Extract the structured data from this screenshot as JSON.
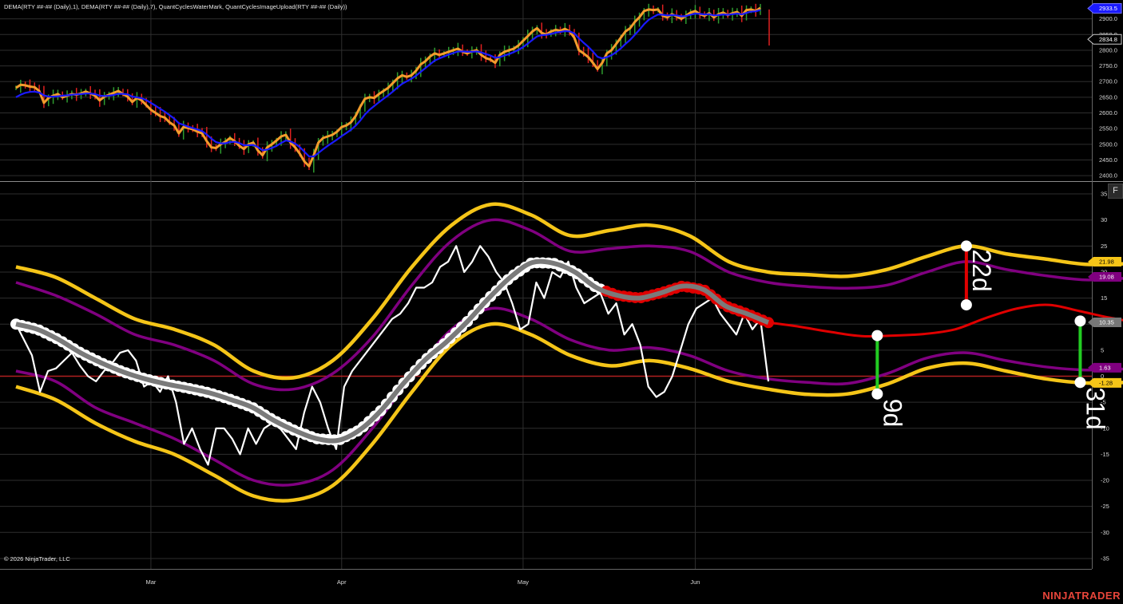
{
  "window": {
    "indicator_line": "DEMA(RTY ##-## (Daily),1), DEMA(RTY ##-## (Daily),7), QuantCyclesWaterMark, QuantCyclesImageUpload(RTY ##-## (Daily))",
    "copyright": "© 2026 NinjaTrader, LLC",
    "logo": "NINJATRADER",
    "panel_button": "F"
  },
  "colors": {
    "background": "#000000",
    "grid": "#2e2e2e",
    "bar_up": "#2e9b2e",
    "bar_down": "#e02020",
    "dema_fast": "#f39c2c",
    "dema_slow": "#1a1aff",
    "band_outer": "#f5c518",
    "band_inner": "#800080",
    "forecast": "#e00000",
    "cycle_main": "#7a7a7a",
    "oscillator": "#ffffff",
    "zero_line": "#b02020",
    "marker_green": "#22cc22"
  },
  "chart_data": [
    {
      "type": "line",
      "panel": "price",
      "ylim": [
        2385,
        2950
      ],
      "yticks": [
        "2400.0",
        "2450.0",
        "2500.0",
        "2550.0",
        "2600.0",
        "2650.0",
        "2700.0",
        "2750.0",
        "2800.0",
        "2850.0",
        "2900.0"
      ],
      "grid": true,
      "x": [
        0,
        1,
        2,
        3,
        4,
        5,
        6,
        7,
        8,
        9,
        10,
        11,
        12,
        13,
        14,
        15,
        16,
        17,
        18,
        19,
        20,
        21,
        22,
        23,
        24,
        25,
        26,
        27,
        28,
        29,
        30,
        31,
        32,
        33,
        34,
        35,
        36,
        37,
        38,
        39,
        40,
        41,
        42,
        43,
        44,
        45,
        46,
        47,
        48,
        49,
        50,
        51,
        52,
        53,
        54,
        55,
        56,
        57,
        58,
        59,
        60,
        61,
        62,
        63,
        64,
        65,
        66,
        67,
        68,
        69,
        70,
        71,
        72,
        73,
        74,
        75,
        76,
        77,
        78,
        79,
        80,
        81,
        82,
        83,
        84,
        85,
        86,
        87,
        88,
        89,
        90,
        91,
        92,
        93,
        94,
        95,
        96,
        97,
        98,
        99,
        100,
        101,
        102,
        103,
        104,
        105,
        106,
        107,
        108,
        109,
        110,
        111,
        112,
        113,
        114,
        115,
        116,
        117,
        118,
        119,
        120,
        121,
        122,
        123,
        124,
        125,
        126,
        127,
        128,
        129,
        130,
        131,
        132,
        133,
        134,
        135,
        136,
        137,
        138,
        139,
        140,
        141,
        142,
        143,
        144,
        145,
        146,
        147,
        148,
        149,
        150,
        151,
        152,
        153,
        154,
        155,
        156,
        157,
        158,
        159,
        160
      ],
      "x_tick_labels": [
        {
          "x": 29,
          "label": "Mar"
        },
        {
          "x": 70,
          "label": "Apr"
        },
        {
          "x": 109,
          "label": "May"
        },
        {
          "x": 146,
          "label": "Jun"
        }
      ],
      "series": [
        {
          "role": "fast",
          "values": [
            2680,
            2690,
            2688,
            2684,
            2682,
            2670,
            2632,
            2648,
            2655,
            2660,
            2650,
            2655,
            2660,
            2658,
            2662,
            2668,
            2662,
            2655,
            2640,
            2652,
            2658,
            2664,
            2670,
            2660,
            2652,
            2635,
            2648,
            2640,
            2625,
            2610,
            2600,
            2590,
            2585,
            2570,
            2560,
            2535,
            2555,
            2552,
            2548,
            2540,
            2535,
            2510,
            2490,
            2488,
            2500,
            2508,
            2520,
            2510,
            2495,
            2485,
            2500,
            2505,
            2480,
            2465,
            2490,
            2500,
            2512,
            2525,
            2530,
            2505,
            2490,
            2470,
            2445,
            2430,
            2465,
            2505,
            2520,
            2525,
            2530,
            2540,
            2555,
            2560,
            2570,
            2590,
            2620,
            2645,
            2650,
            2648,
            2660,
            2670,
            2680,
            2695,
            2710,
            2720,
            2715,
            2720,
            2735,
            2755,
            2765,
            2780,
            2790,
            2785,
            2790,
            2795,
            2800,
            2805,
            2795,
            2790,
            2796,
            2800,
            2785,
            2775,
            2770,
            2760,
            2785,
            2795,
            2800,
            2805,
            2815,
            2830,
            2845,
            2860,
            2870,
            2855,
            2850,
            2860,
            2865,
            2862,
            2868,
            2860,
            2840,
            2800,
            2790,
            2778,
            2760,
            2740,
            2760,
            2790,
            2800,
            2820,
            2840,
            2860,
            2870,
            2890,
            2905,
            2925,
            2930,
            2928,
            2930,
            2910,
            2905,
            2915,
            2908,
            2900,
            2910,
            2920,
            2925,
            2915,
            2910,
            2918,
            2905,
            2915,
            2920,
            2912,
            2918,
            2922,
            2910,
            2928,
            2930,
            2925,
            2935
          ]
        },
        {
          "role": "slow",
          "values": [
            2650,
            2658,
            2664,
            2667,
            2668,
            2665,
            2656,
            2652,
            2652,
            2653,
            2655,
            2656,
            2658,
            2659,
            2660,
            2662,
            2662,
            2660,
            2655,
            2654,
            2655,
            2657,
            2661,
            2661,
            2659,
            2652,
            2650,
            2647,
            2641,
            2632,
            2623,
            2613,
            2604,
            2593,
            2582,
            2567,
            2562,
            2556,
            2552,
            2547,
            2542,
            2531,
            2518,
            2507,
            2503,
            2503,
            2507,
            2508,
            2504,
            2497,
            2497,
            2498,
            2491,
            2481,
            2483,
            2488,
            2495,
            2504,
            2512,
            2509,
            2502,
            2491,
            2476,
            2461,
            2461,
            2472,
            2484,
            2495,
            2505,
            2515,
            2526,
            2536,
            2546,
            2559,
            2576,
            2595,
            2610,
            2622,
            2634,
            2645,
            2656,
            2668,
            2681,
            2693,
            2701,
            2709,
            2719,
            2731,
            2743,
            2755,
            2767,
            2774,
            2780,
            2786,
            2791,
            2796,
            2796,
            2795,
            2795,
            2796,
            2793,
            2788,
            2783,
            2776,
            2778,
            2783,
            2788,
            2794,
            2801,
            2810,
            2821,
            2833,
            2844,
            2848,
            2849,
            2852,
            2856,
            2858,
            2861,
            2860,
            2854,
            2838,
            2824,
            2811,
            2796,
            2779,
            2774,
            2778,
            2784,
            2794,
            2806,
            2820,
            2833,
            2849,
            2865,
            2883,
            2897,
            2906,
            2914,
            2913,
            2911,
            2912,
            2911,
            2908,
            2909,
            2913,
            2917,
            2916,
            2914,
            2915,
            2911,
            2912,
            2914,
            2913,
            2915,
            2917,
            2914,
            2919,
            2923,
            2924,
            2928
          ]
        }
      ]
    },
    {
      "type": "line",
      "panel": "cycle",
      "ylim": [
        -37,
        37
      ],
      "yticks": [
        "35",
        "30",
        "25",
        "20",
        "15",
        "10",
        "5",
        "0",
        "-5",
        "-10",
        "-15",
        "-20",
        "-25",
        "-30",
        "-35"
      ],
      "grid": true,
      "x": [
        0,
        8,
        16,
        24,
        32,
        40,
        48,
        56,
        64,
        72,
        80,
        88,
        96,
        104,
        112,
        120,
        128,
        136,
        144,
        152,
        160,
        168,
        176,
        184,
        192,
        200,
        208,
        216,
        224,
        232,
        240
      ],
      "forecast_start": 152,
      "bands": {
        "outer_upper": [
          21,
          19,
          15,
          11,
          9,
          6,
          1,
          -0.3,
          3,
          11,
          21,
          29,
          33,
          31,
          27,
          28,
          29,
          27,
          22,
          20,
          19.5,
          19.2,
          20.5,
          23,
          25,
          23.5,
          22.5,
          21.5,
          21.6,
          21.9,
          22.1
        ],
        "inner_upper": [
          18,
          15.5,
          12,
          8,
          6,
          3,
          -1.5,
          -2.5,
          0.5,
          7.5,
          17.5,
          26,
          30,
          28,
          24,
          24.5,
          25,
          24,
          20,
          18,
          17.2,
          16.9,
          17.5,
          20,
          22,
          20.5,
          19.3,
          18.5,
          18.8,
          19,
          19.3
        ],
        "inner_lower": [
          1,
          -1,
          -6,
          -9,
          -12,
          -16,
          -20,
          -20.8,
          -18,
          -10,
          0,
          9,
          13,
          11,
          7,
          5,
          5.5,
          4,
          1,
          -0.5,
          -1.2,
          -1.4,
          0.5,
          3.5,
          4.5,
          3,
          1.8,
          1.2,
          1.4,
          1.6,
          1.8
        ],
        "outer_lower": [
          -2,
          -4.5,
          -9,
          -12.5,
          -15,
          -19,
          -23,
          -23.8,
          -21,
          -13,
          -3,
          6,
          10,
          8,
          4,
          2,
          3,
          1.5,
          -1,
          -2.5,
          -3.5,
          -3.4,
          -1.5,
          1.5,
          2.5,
          1,
          -0.5,
          -1.3,
          -1.2,
          -1.1,
          -1
        ]
      },
      "cycle": [
        10,
        9,
        7,
        4.5,
        2.5,
        0.8,
        -0.5,
        -1.5,
        -2.3,
        -3.2,
        -4.5,
        -6,
        -8.5,
        -10.5,
        -12,
        -12.3,
        -10.3,
        -6.5,
        -1.5,
        3,
        6.5,
        10.5,
        15,
        19,
        21.8,
        21.7,
        20,
        17,
        15.5,
        15,
        16,
        17.3,
        16.6,
        13.5,
        12,
        10.3
      ],
      "forecast": [
        10.3,
        9.5,
        8.5,
        7.7,
        7.8,
        8.1,
        9,
        11.2,
        13,
        13.7,
        12.5,
        11.2,
        10.3,
        10.6,
        10.9
      ],
      "oscillator": [
        10,
        7,
        4,
        -3,
        1,
        1.5,
        3,
        4.5,
        2,
        0,
        -1,
        1,
        2.5,
        4.5,
        5,
        3,
        -2,
        -1,
        -3,
        0,
        -5,
        -13,
        -10,
        -14,
        -17,
        -10,
        -10,
        -12,
        -15,
        -10,
        -13,
        -10,
        -9,
        -10,
        -12,
        -14,
        -7,
        -2,
        -5,
        -10,
        -14,
        -2,
        1,
        3,
        5,
        7,
        9,
        11,
        12,
        14,
        17,
        17,
        18,
        21,
        22,
        25,
        20,
        22,
        25,
        23,
        20,
        18,
        14,
        9,
        10,
        18,
        15,
        20,
        19,
        22,
        17,
        14,
        15,
        16,
        12,
        14,
        8,
        10,
        6,
        -2,
        -4,
        -3,
        0,
        5,
        10,
        13,
        14,
        15,
        12,
        10,
        8,
        12,
        9,
        11,
        -1
      ],
      "oscillator_x0": 0,
      "oscillator_x1": 152,
      "markers": [
        {
          "x": 174,
          "y_top": 7.8,
          "y_bottom": -3.4,
          "color": "green",
          "label": "9d"
        },
        {
          "x": 192,
          "y_top": 25,
          "y_bottom": 13.7,
          "color": "red",
          "label": "22d"
        },
        {
          "x": 215,
          "y_top": 10.6,
          "y_bottom": -1.2,
          "color": "green",
          "label": "31d"
        }
      ],
      "right_tags": [
        {
          "value": 21.98,
          "label": "21.98",
          "color": "yellow"
        },
        {
          "value": 19.08,
          "label": "19.08",
          "color": "purple"
        },
        {
          "value": 10.35,
          "label": "10.35",
          "color": "gray"
        },
        {
          "value": 1.63,
          "label": "1.63",
          "color": "purple"
        },
        {
          "value": -1.28,
          "label": "-1.28",
          "color": "yellow"
        }
      ],
      "price_tags": [
        {
          "value": 2933.5,
          "label": "2933.5",
          "color": "blue"
        },
        {
          "value": 2834.8,
          "label": "2834.8",
          "color": "dark"
        }
      ]
    }
  ]
}
